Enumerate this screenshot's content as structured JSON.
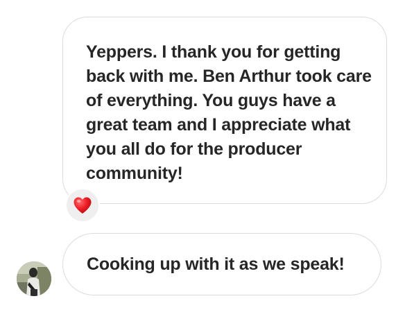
{
  "messages": [
    {
      "text": "Yeppers. I thank you for getting back with me. Ben Arthur took care of everything. You guys have a great team and I appreciate what you all do for the producer community!",
      "reaction": {
        "icon": "heart-icon",
        "color": "#ed1c24"
      }
    },
    {
      "text": "Cooking up with it as we speak!",
      "sender_avatar": "avatar"
    }
  ],
  "colors": {
    "bubble_border": "#dbdbdb",
    "text": "#262626",
    "reaction_bg": "#efefef"
  }
}
